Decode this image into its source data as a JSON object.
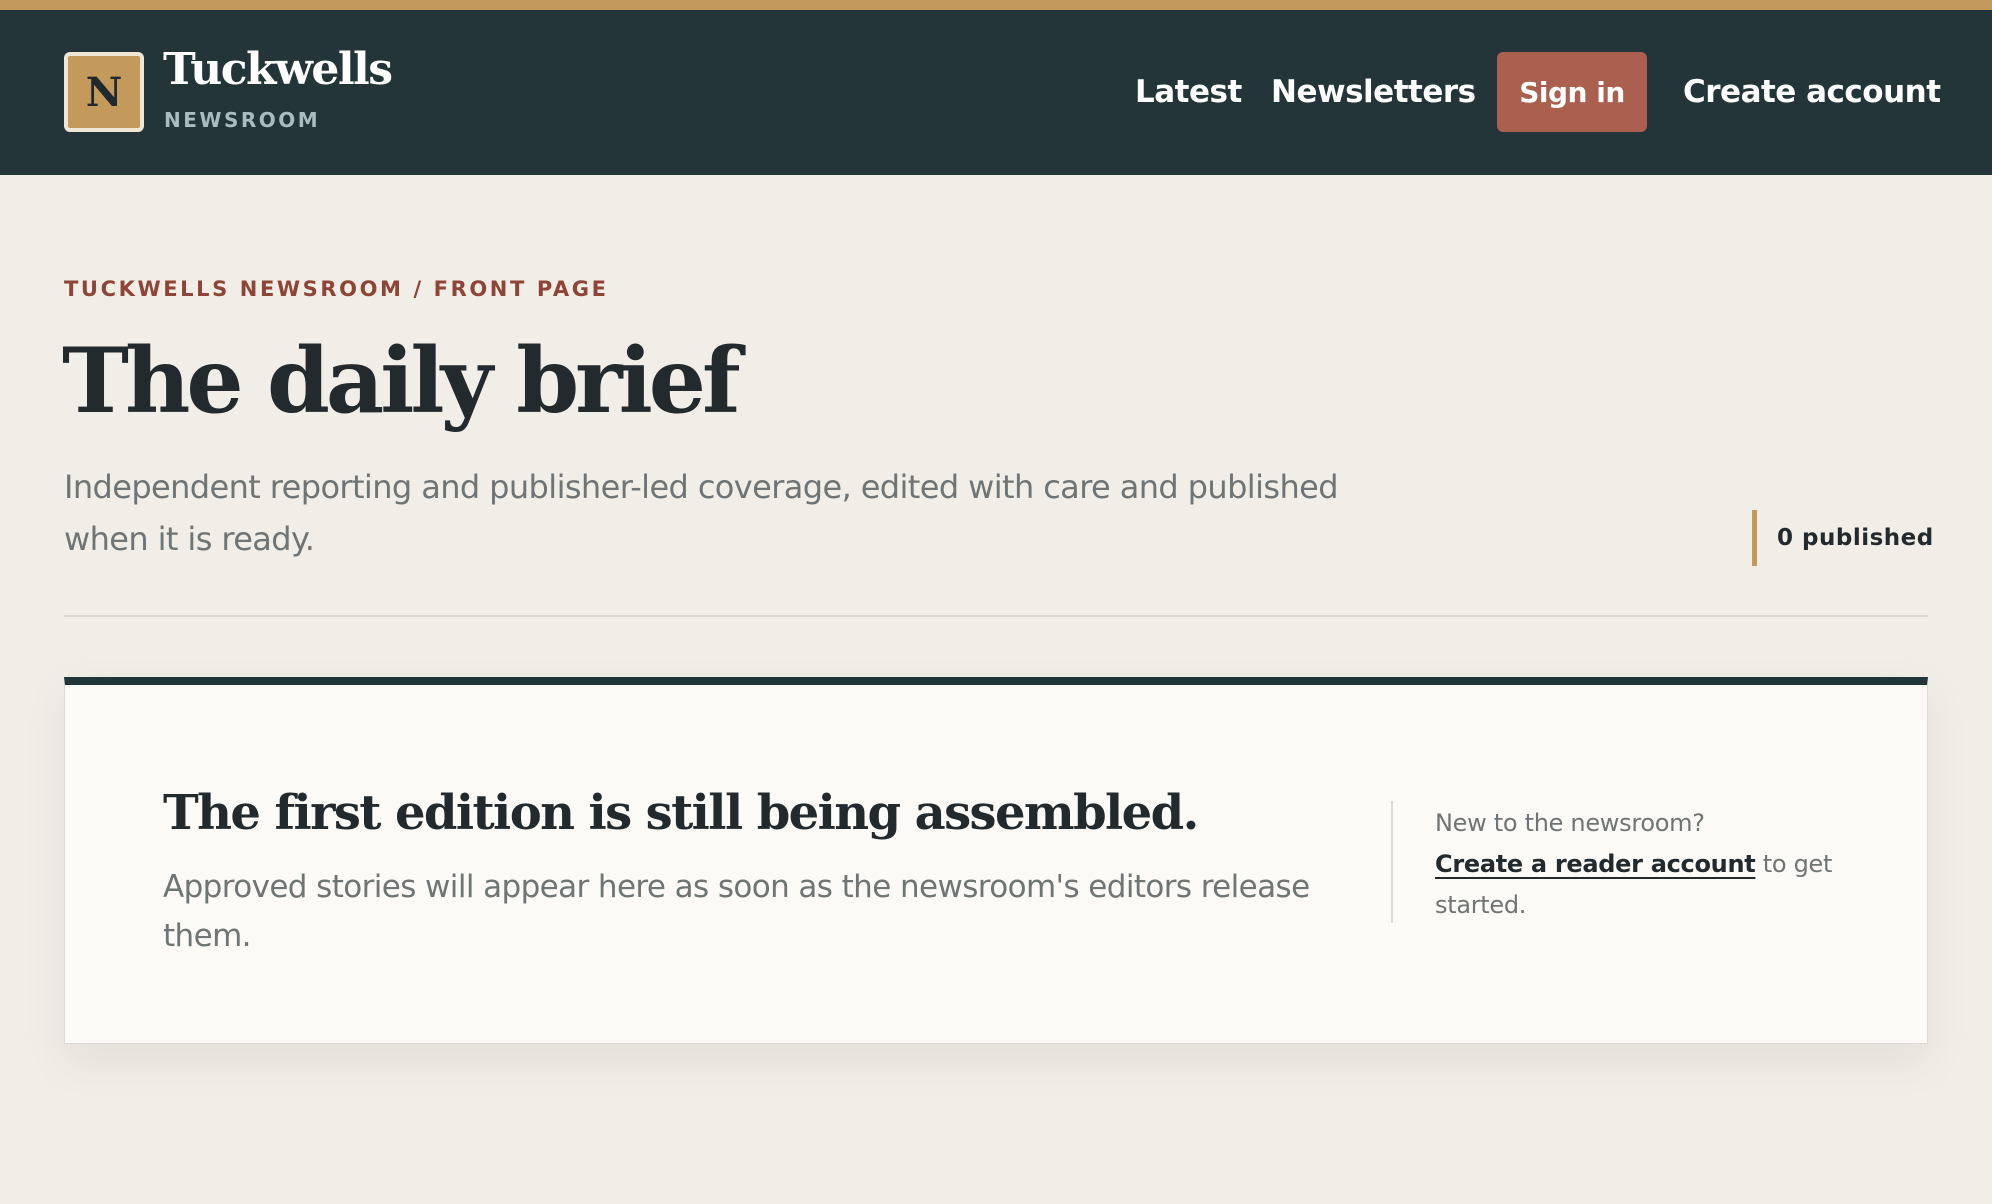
{
  "colors": {
    "top_stripe": "#c49a5c",
    "header_bg": "#233538",
    "logo_bg": "#c49a5c",
    "signin_bg": "#ab5f4e",
    "crumb": "#8e4436",
    "accent_gold": "#c49a5c",
    "card_top_border": "#22363a"
  },
  "header": {
    "logo_letter": "N",
    "logo_icon": "newspaper-monogram-icon",
    "brand_name": "Tuckwells",
    "brand_sub": "NEWSROOM",
    "nav": {
      "latest": "Latest",
      "newsletters": "Newsletters",
      "signin": "Sign in",
      "create_account": "Create account"
    }
  },
  "hero": {
    "breadcrumb": "TUCKWELLS NEWSROOM / FRONT PAGE",
    "title": "The daily brief",
    "subtitle": "Independent reporting and publisher-led coverage, edited with care and published when it is ready.",
    "published_count": "0 published"
  },
  "empty_state": {
    "heading": "The first edition is still being assembled.",
    "body": "Approved stories will appear here as soon as the newsroom's editors release them.",
    "side_question": "New to the newsroom?",
    "side_link": "Create a reader account",
    "side_suffix": "to get started."
  }
}
